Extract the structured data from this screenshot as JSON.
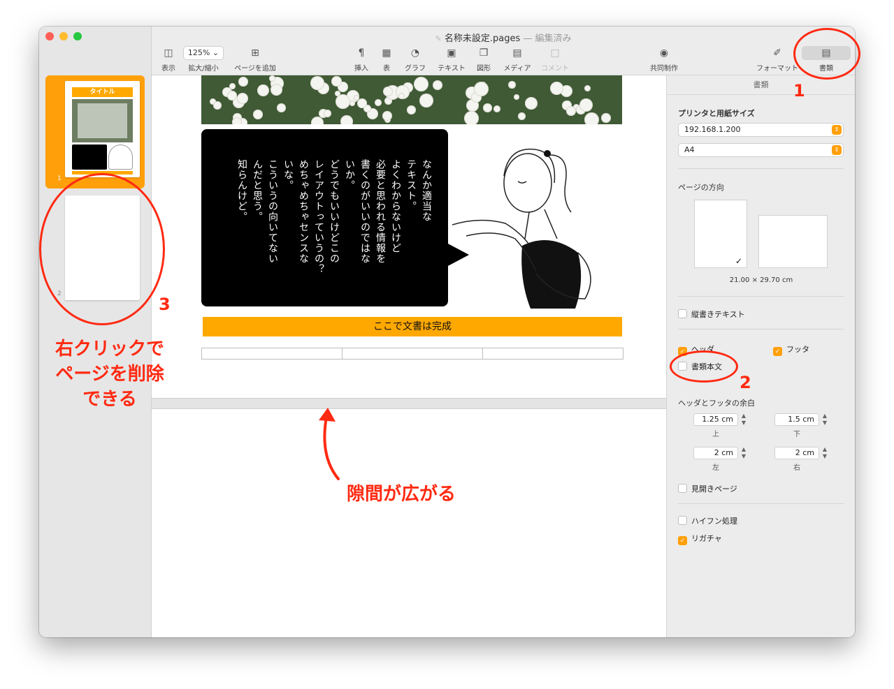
{
  "window": {
    "title": "名称未設定.pages",
    "title_sep": " — ",
    "title_status": "編集済み"
  },
  "toolbar": {
    "view": "表示",
    "zoom_value": "125%",
    "zoom": "拡大/縮小",
    "add_page": "ページを追加",
    "insert": "挿入",
    "table": "表",
    "chart": "グラフ",
    "text": "テキスト",
    "shape": "図形",
    "media": "メディア",
    "comment": "コメント",
    "collaborate": "共同制作",
    "format": "フォーマット",
    "document": "書類"
  },
  "thumbnails": [
    {
      "number": "1",
      "title": "タイトル"
    },
    {
      "number": "2"
    }
  ],
  "document": {
    "bubble_text": "なんか適当な\nテキスト。\nよくわからないけど\n必要と思われる情報を\n書くのがいいのではな\nいか。\nどうでもいいけどこの\nレイアウトっていうの？\nめちゃめちゃセンスな\nいな。\nこういうの向いてない\nんだと思う。\n知らんけど。",
    "banner": "ここで文書は完成"
  },
  "inspector": {
    "tab": "書類",
    "printer_section": "プリンタと用紙サイズ",
    "printer": "192.168.1.200",
    "paper": "A4",
    "orientation_section": "ページの方向",
    "paper_size": "21.00 × 29.70 cm",
    "vertical_text": "縦書きテキスト",
    "header": "ヘッダ",
    "footer": "フッタ",
    "body": "書類本文",
    "margins_section": "ヘッダとフッタの余白",
    "top_value": "1.25 cm",
    "top_label": "上",
    "bottom_value": "1.5 cm",
    "bottom_label": "下",
    "left_value": "2 cm",
    "left_label": "左",
    "right_value": "2 cm",
    "right_label": "右",
    "facing_pages": "見開きページ",
    "hyphenation": "ハイフン処理",
    "ligatures": "リガチャ"
  },
  "annotations": {
    "num1": "1",
    "num2": "2",
    "num3": "3",
    "delete_note": "右クリックで\nページを削除\nできる",
    "gap_note": "隙間が広がる"
  },
  "colors": {
    "accent": "#ff9f0a",
    "annotation": "#ff2a12"
  }
}
